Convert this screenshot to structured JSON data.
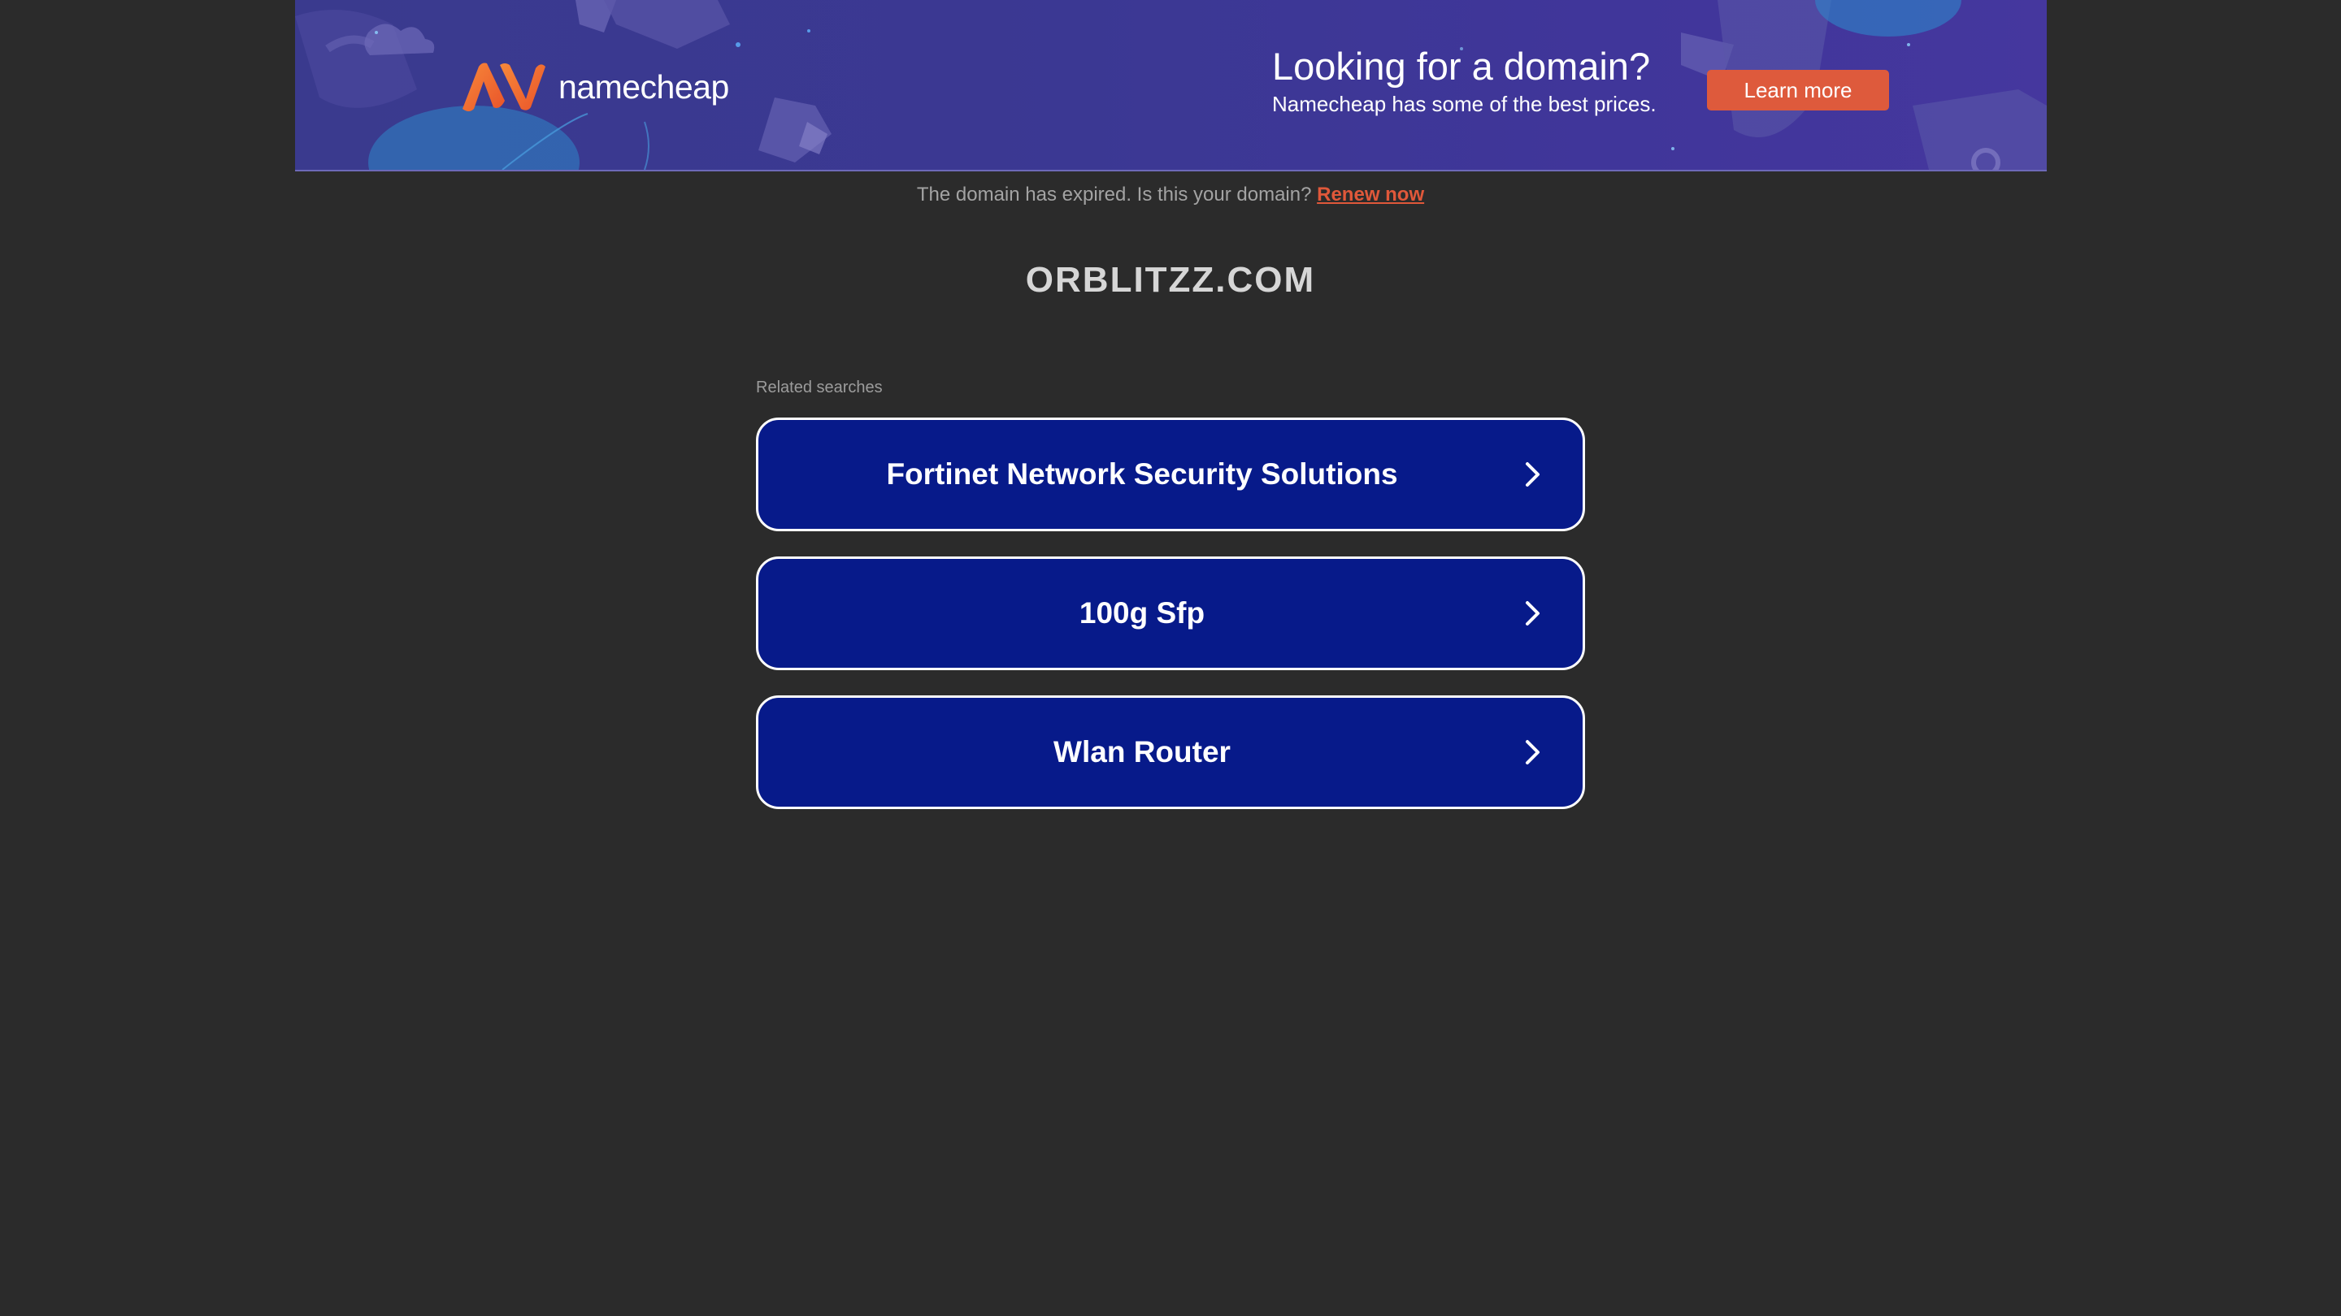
{
  "banner": {
    "logo_text": "namecheap",
    "headline": "Looking for a domain?",
    "subline": "Namecheap has some of the best prices.",
    "cta_label": "Learn more",
    "colors": {
      "background": "#3b3893",
      "cta": "#de5a3c",
      "logo_orange": "#f26b2d"
    }
  },
  "notice": {
    "text": "The domain has expired. Is this your domain?",
    "link_label": "Renew now",
    "link_color": "#e0583a"
  },
  "domain_name": "ORBLITZZ.COM",
  "related": {
    "label": "Related searches",
    "items": [
      {
        "label": "Fortinet Network Security Solutions",
        "icon": "chevron-right-icon"
      },
      {
        "label": "100g Sfp",
        "icon": "chevron-right-icon"
      },
      {
        "label": "Wlan Router",
        "icon": "chevron-right-icon"
      }
    ],
    "button_color": "#071a8a"
  },
  "page_background": "#2b2b2b"
}
